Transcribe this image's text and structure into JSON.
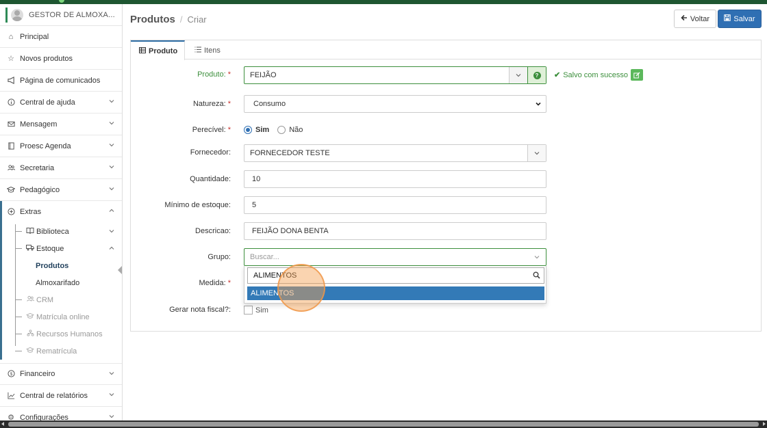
{
  "sidebar": {
    "user_name": "GESTOR DE ALMOXA...",
    "items": [
      {
        "label": "Principal",
        "icon": "home-icon"
      },
      {
        "label": "Novos produtos",
        "icon": "star-icon"
      },
      {
        "label": "Página de comunicados",
        "icon": "megaphone-icon"
      },
      {
        "label": "Central de ajuda",
        "icon": "info-icon"
      },
      {
        "label": "Mensagem",
        "icon": "envelope-icon"
      },
      {
        "label": "Proesc Agenda",
        "icon": "book-icon"
      },
      {
        "label": "Secretaria",
        "icon": "users-icon"
      },
      {
        "label": "Pedagógico",
        "icon": "graduation-cap-icon"
      },
      {
        "label": "Extras",
        "icon": "plus-circle-icon"
      }
    ],
    "extras_sub": {
      "biblioteca": "Biblioteca",
      "estoque": "Estoque",
      "produtos": "Produtos",
      "almoxarifado": "Almoxarifado",
      "crm": "CRM",
      "matricula": "Matrícula online",
      "rh": "Recursos Humanos",
      "rematricula": "Rematrícula"
    },
    "bottom_items": [
      {
        "label": "Financeiro",
        "icon": "dollar-icon"
      },
      {
        "label": "Central de relatórios",
        "icon": "chart-icon"
      },
      {
        "label": "Configurações",
        "icon": "gear-icon"
      }
    ]
  },
  "header": {
    "title": "Produtos",
    "separator": "/",
    "current": "Criar",
    "back_label": "Voltar",
    "save_label": "Salvar"
  },
  "tabs": {
    "produto": "Produto",
    "itens": "Itens"
  },
  "form": {
    "produto_label": "Produto:",
    "produto_value": "FEIJÃO",
    "saved_text": "Salvo com sucesso",
    "natureza_label": "Natureza:",
    "natureza_value": "Consumo",
    "perecivel_label": "Perecível:",
    "perecivel_sim": "Sim",
    "perecivel_nao": "Não",
    "fornecedor_label": "Fornecedor:",
    "fornecedor_value": "FORNECEDOR TESTE",
    "quantidade_label": "Quantidade:",
    "quantidade_value": "10",
    "minimo_label": "Mínimo de estoque:",
    "minimo_value": "5",
    "descricao_label": "Descricao:",
    "descricao_value": "FEIJÃO DONA BENTA",
    "grupo_label": "Grupo:",
    "grupo_placeholder": "Buscar...",
    "grupo_search": "ALIMENTOS",
    "grupo_option": "ALIMENTOS",
    "medida_label": "Medida:",
    "nota_label": "Gerar nota fiscal?:",
    "nota_option": "Sim",
    "required_mark": "*"
  }
}
